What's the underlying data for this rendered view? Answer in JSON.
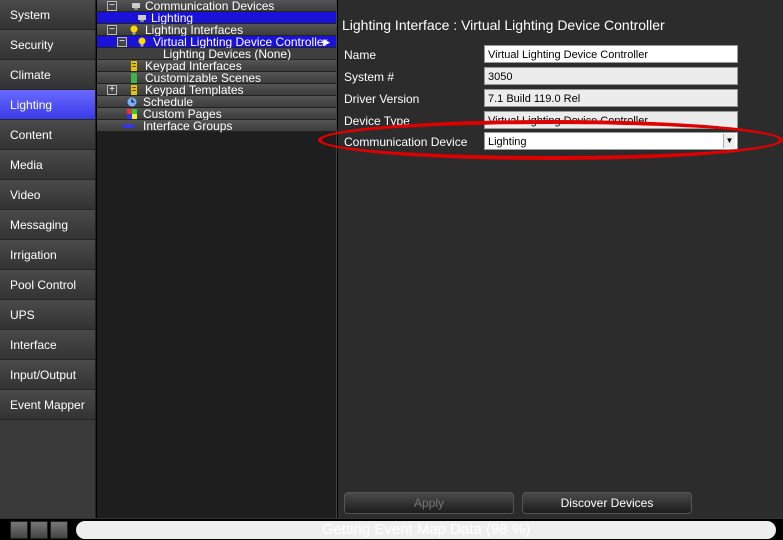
{
  "nav": {
    "items": [
      {
        "label": "System"
      },
      {
        "label": "Security"
      },
      {
        "label": "Climate"
      },
      {
        "label": "Lighting",
        "active": true
      },
      {
        "label": "Content"
      },
      {
        "label": "Media"
      },
      {
        "label": "Video"
      },
      {
        "label": "Messaging"
      },
      {
        "label": "Irrigation"
      },
      {
        "label": "Pool Control"
      },
      {
        "label": "UPS"
      },
      {
        "label": "Interface"
      },
      {
        "label": "Input/Output"
      },
      {
        "label": "Event Mapper"
      }
    ]
  },
  "tree": {
    "communication_devices": "Communication Devices",
    "lighting": "Lighting",
    "lighting_interfaces": "Lighting Interfaces",
    "virtual_controller": "Virtual Lighting Device Controller",
    "lighting_devices": "Lighting Devices (None)",
    "keypad_interfaces": "Keypad Interfaces",
    "customizable_scenes": "Customizable Scenes",
    "keypad_templates": "Keypad Templates",
    "schedule": "Schedule",
    "custom_pages": "Custom Pages",
    "interface_groups": "Interface Groups",
    "expanded_symbol": "−",
    "collapsed_symbol": "+",
    "arrow_symbol": "▶"
  },
  "content": {
    "title": "Lighting Interface : Virtual Lighting Device Controller",
    "fields": {
      "name_label": "Name",
      "name_value": "Virtual Lighting Device Controller",
      "system_label": "System #",
      "system_value": "3050",
      "driver_label": "Driver Version",
      "driver_value": "7.1 Build 119.0 Rel",
      "type_label": "Device Type",
      "type_value": "Virtual Lighting Device Controller",
      "comm_label": "Communication Device",
      "comm_value": "Lighting",
      "comm_dropdown_symbol": "▼"
    },
    "buttons": {
      "apply": "Apply",
      "discover": "Discover Devices"
    },
    "highlight_color": "#e00000"
  },
  "status": {
    "text": "Getting Event Map Data (98 %)"
  },
  "colors": {
    "accent_selected": "#1a12d8",
    "nav_active": "#4a4af0"
  }
}
